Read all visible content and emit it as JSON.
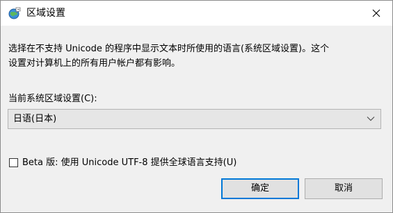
{
  "window": {
    "title": "区域设置",
    "icon": "region-globe-icon",
    "close_icon": "close-icon"
  },
  "description": {
    "line1": "选择在不支持 Unicode 的程序中显示文本时所使用的语言(系统区域设置)。这个",
    "line2": "设置对计算机上的所有用户帐户都有影响。"
  },
  "locale": {
    "label": "当前系统区域设置(C):",
    "selected": "日语(日本)"
  },
  "beta": {
    "label": "Beta 版: 使用 Unicode UTF-8 提供全球语言支持(U)",
    "checked": false
  },
  "buttons": {
    "ok": "确定",
    "cancel": "取消"
  },
  "colors": {
    "accent": "#0078d7",
    "dialog_bg": "#f0f0f0",
    "titlebar_bg": "#ffffff"
  }
}
